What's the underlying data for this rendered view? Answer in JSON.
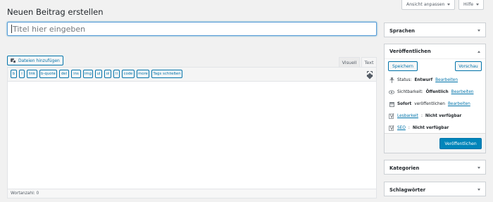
{
  "screen_options": {
    "label": "Ansicht anpassen"
  },
  "help": {
    "label": "Hilfe"
  },
  "page_title": "Neuen Beitrag erstellen",
  "title_input": {
    "placeholder": "Titel hier eingeben"
  },
  "media_button": {
    "label": "Dateien hinzufügen"
  },
  "editor_tabs": {
    "visual": "Visuell",
    "text": "Text"
  },
  "quicktags": [
    "b",
    "i",
    "link",
    "b-quote",
    "del",
    "ins",
    "img",
    "ul",
    "ol",
    "li",
    "code",
    "more",
    "Tags schließen"
  ],
  "word_count": "Wortanzahl: 0",
  "sidebar": {
    "languages": {
      "title": "Sprachen"
    },
    "publish": {
      "title": "Veröffentlichen",
      "save_draft": "Speichern",
      "preview": "Vorschau",
      "status_label": "Status:",
      "status_value": "Entwurf",
      "visibility_label": "Sichtbarkeit:",
      "visibility_value": "Öffentlich",
      "schedule_bold": "Sofort",
      "schedule_rest": "veröffentlichen",
      "edit_link": "Bearbeiten",
      "readability_link": "Lesbarkeit",
      "readability_value": "Nicht verfügbar",
      "seo_link": "SEO",
      "seo_value": "Nicht verfügbar",
      "publish_button": "Veröffentlichen"
    },
    "categories": {
      "title": "Kategorien"
    },
    "tags": {
      "title": "Schlagwörter"
    }
  },
  "colors": {
    "accent": "#0073aa",
    "primary_button": "#0085ba"
  }
}
